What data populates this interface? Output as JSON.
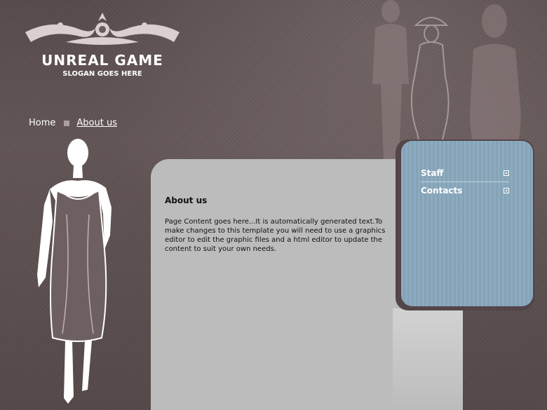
{
  "header": {
    "title": "UNREAL GAME",
    "slogan": "SLOGAN GOES HERE"
  },
  "breadcrumb": {
    "home": "Home",
    "current": "About us"
  },
  "content": {
    "heading": "About us",
    "body": "Page Content goes here...It is automatically generated text.To make changes to this template you will need to use a graphics editor to edit the graphic files and a html editor to update the content to suit your own needs."
  },
  "sidebar": {
    "items": [
      {
        "label": "Staff"
      },
      {
        "label": "Contacts"
      }
    ]
  },
  "colors": {
    "background": "#5a4d4e",
    "content_panel": "#bcbcbc",
    "sidebar_panel": "#88a8bc"
  },
  "icons": [
    "logo-ornament",
    "fashion-figure",
    "silhouettes",
    "menu-bullet-icon"
  ]
}
